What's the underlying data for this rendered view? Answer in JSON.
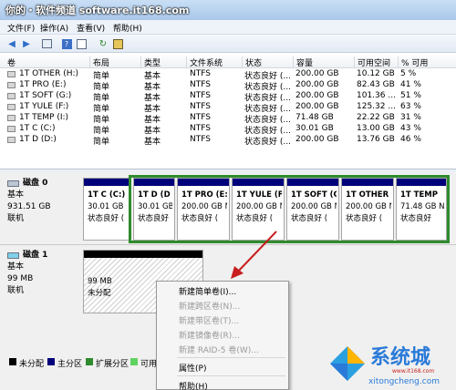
{
  "titlebar": {
    "caption": "你的・软件频道 software.it168.com"
  },
  "menu": {
    "items": [
      "文件(F)",
      "操作(A)",
      "查看(V)",
      "帮助(H)"
    ]
  },
  "toolbar": {
    "icons": [
      "back-arrow-icon",
      "forward-arrow-icon",
      "list-view-icon",
      "help-icon",
      "properties-icon",
      "refresh-icon",
      "disk-icon"
    ]
  },
  "volumes": {
    "headers": [
      "卷",
      "布局",
      "类型",
      "文件系统",
      "状态",
      "容量",
      "可用空间",
      "% 可用"
    ],
    "rows": [
      [
        "1T OTHER (H:)",
        "简单",
        "基本",
        "NTFS",
        "状态良好 (...",
        "200.00 GB",
        "10.12 GB",
        "5 %"
      ],
      [
        "1T PRO (E:)",
        "简单",
        "基本",
        "NTFS",
        "状态良好 (...",
        "200.00 GB",
        "82.43 GB",
        "41 %"
      ],
      [
        "1T SOFT (G:)",
        "简单",
        "基本",
        "NTFS",
        "状态良好 (...",
        "200.00 GB",
        "101.36 ...",
        "51 %"
      ],
      [
        "1T YULE (F:)",
        "简单",
        "基本",
        "NTFS",
        "状态良好 (...",
        "200.00 GB",
        "125.32 ...",
        "63 %"
      ],
      [
        "1T TEMP (I:)",
        "简单",
        "基本",
        "NTFS",
        "状态良好 (...",
        "71.48 GB",
        "22.22 GB",
        "31 %"
      ],
      [
        "1T C (C:)",
        "简单",
        "基本",
        "NTFS",
        "状态良好 (...",
        "30.01 GB",
        "13.00 GB",
        "43 %"
      ],
      [
        "1T D (D:)",
        "简单",
        "基本",
        "NTFS",
        "状态良好 (...",
        "200.00 GB",
        "13.76 GB",
        "46 %"
      ]
    ]
  },
  "disk0": {
    "name": "磁盘 0",
    "type": "基本",
    "size": "931.51 GB",
    "state": "联机",
    "partitions": [
      {
        "name": "1T C  (C:)",
        "size": "30.01 GB",
        "status": "状态良好 (",
        "color": "#00007a"
      },
      {
        "name": "1T D  (D",
        "size": "30.01 GB",
        "status": "状态良好",
        "color": "#00007a"
      },
      {
        "name": "1T PRO  (E:",
        "size": "200.00 GB N",
        "status": "状态良好 (",
        "color": "#00007a"
      },
      {
        "name": "1T YULE  (F",
        "size": "200.00 GB N",
        "status": "状态良好 (",
        "color": "#00007a"
      },
      {
        "name": "1T SOFT  (C",
        "size": "200.00 GB N",
        "status": "状态良好 (",
        "color": "#00007a"
      },
      {
        "name": "1T OTHER",
        "size": "200.00 GB N",
        "status": "状态良好 (",
        "color": "#00007a"
      },
      {
        "name": "1T TEMP",
        "size": "71.48 GB N",
        "status": "状态良好",
        "color": "#00007a"
      }
    ]
  },
  "disk1": {
    "name": "磁盘 1",
    "type": "基本",
    "size": "99 MB",
    "state": "联机",
    "partition": {
      "size": "99 MB",
      "status": "未分配",
      "color": "#000000"
    }
  },
  "context_menu": {
    "items": [
      {
        "label": "新建简单卷(I)...",
        "enabled": true
      },
      {
        "label": "新建跨区卷(N)...",
        "enabled": false
      },
      {
        "label": "新建带区卷(T)...",
        "enabled": false
      },
      {
        "label": "新建镜像卷(R)...",
        "enabled": false
      },
      {
        "label": "新建 RAID-5 卷(W)...",
        "enabled": false
      },
      {
        "label": "属性(P)",
        "enabled": true
      },
      {
        "label": "帮助(H)",
        "enabled": true
      }
    ]
  },
  "legend": {
    "items": [
      {
        "label": "未分配",
        "color": "#000000"
      },
      {
        "label": "主分区",
        "color": "#00007a"
      },
      {
        "label": "扩展分区",
        "color": "#2e8b2e"
      },
      {
        "label": "可用",
        "color": "#5fd35f"
      }
    ]
  },
  "watermark": {
    "brand": "系统城",
    "url": "xitongcheng.com",
    "small": "www.it168.com"
  }
}
